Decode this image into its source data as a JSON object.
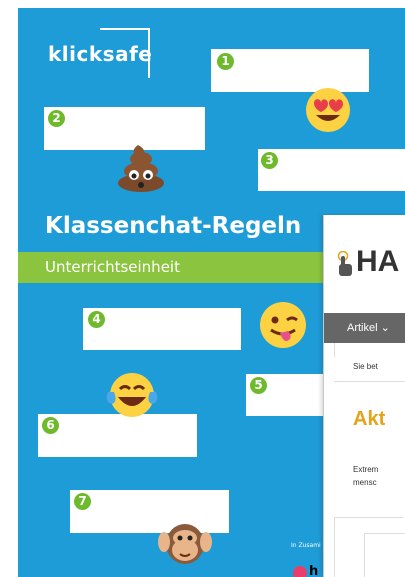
{
  "poster": {
    "logo": "klicksafe",
    "title": "Klassenchat-Regeln",
    "subtitle": "Unterrichtseinheit",
    "numbers": [
      "1",
      "2",
      "3",
      "4",
      "5",
      "6",
      "7"
    ],
    "partner_label": "In Zusami",
    "partner_text": "h",
    "colors": {
      "background": "#1e9cd7",
      "accent": "#8bc53f",
      "badge": "#6fba2c"
    }
  },
  "window": {
    "brand": "HA",
    "nav_item": "Artikel ⌄",
    "breadcrumb": "Sie bet",
    "headline": "Akt",
    "body_lines": [
      "Extrem",
      "mensc"
    ],
    "colors": {
      "navbar": "#666666",
      "headline": "#e5a21a"
    }
  }
}
